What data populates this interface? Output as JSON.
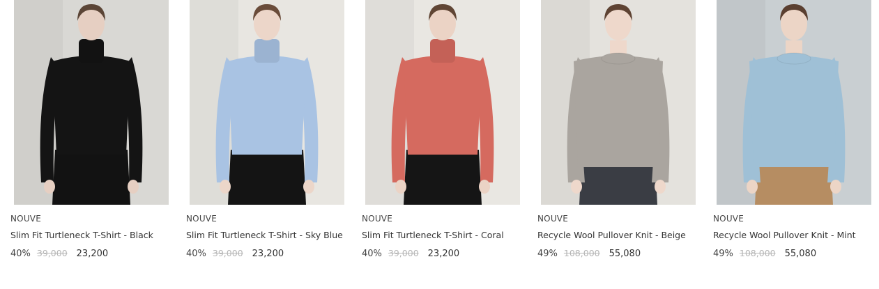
{
  "products": [
    {
      "brand": "NOUVE",
      "name": "Slim Fit Turtleneck T-Shirt - Black",
      "discount": "40%",
      "original_price": "39,000",
      "sale_price": "23,200",
      "colors": {
        "background": "#d9d8d4",
        "garment": "#141414",
        "bottom": "#121212",
        "skin": "#e6cfc2",
        "hair": "#5b4536"
      }
    },
    {
      "brand": "NOUVE",
      "name": "Slim Fit Turtleneck T-Shirt - Sky Blue",
      "discount": "40%",
      "original_price": "39,000",
      "sale_price": "23,200",
      "colors": {
        "background": "#e8e6e1",
        "garment": "#a9c3e3",
        "bottom": "#141414",
        "skin": "#ecd6c9",
        "hair": "#6a4c3a"
      }
    },
    {
      "brand": "NOUVE",
      "name": "Slim Fit Turtleneck T-Shirt - Coral",
      "discount": "40%",
      "original_price": "39,000",
      "sale_price": "23,200",
      "colors": {
        "background": "#e9e7e2",
        "garment": "#d56a5f",
        "bottom": "#151515",
        "skin": "#ebd3c5",
        "hair": "#604534"
      }
    },
    {
      "brand": "NOUVE",
      "name": "Recycle Wool Pullover Knit - Beige",
      "discount": "49%",
      "original_price": "108,000",
      "sale_price": "55,080",
      "colors": {
        "background": "#e4e2dd",
        "garment": "#aaa59f",
        "bottom": "#3a3d44",
        "skin": "#eed8cb",
        "hair": "#5e4333"
      }
    },
    {
      "brand": "NOUVE",
      "name": "Recycle Wool Pullover Knit - Mint",
      "discount": "49%",
      "original_price": "108,000",
      "sale_price": "55,080",
      "colors": {
        "background": "#c9cfd2",
        "garment": "#9fc0d6",
        "bottom": "#b68d62",
        "skin": "#ecd5c6",
        "hair": "#5a3f30"
      }
    }
  ]
}
